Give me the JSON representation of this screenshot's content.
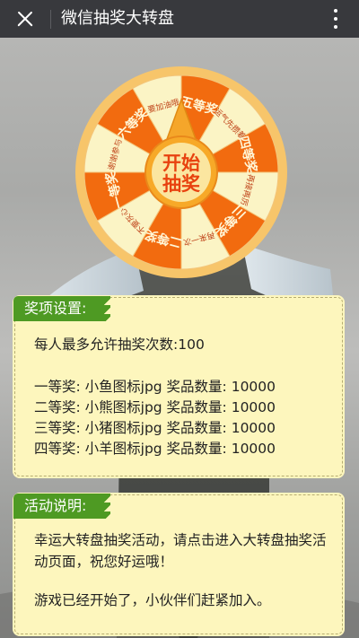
{
  "window": {
    "title": "微信抽奖大转盘"
  },
  "wheel": {
    "segments": [
      "六等奖",
      "要加油哦",
      "五等奖",
      "运气先攒着",
      "四等奖",
      "再接再厉",
      "三等奖",
      "再来一次",
      "二等奖",
      "不要灰心",
      "一等奖",
      "谢谢参与"
    ],
    "start_line1": "开始",
    "start_line2": "抽奖",
    "colors": {
      "orange": "#f26b0f",
      "cream": "#fbf4c5",
      "rim": "#f7c56a"
    }
  },
  "prize_panel": {
    "tag": "奖项设置:",
    "max_draws": "每人最多允许抽奖次数:100",
    "prizes": [
      "一等奖: 小鱼图标jpg 奖品数量: 10000",
      "二等奖: 小熊图标jpg 奖品数量: 10000",
      "三等奖: 小猪图标jpg 奖品数量: 10000",
      "四等奖: 小羊图标jpg 奖品数量: 10000"
    ]
  },
  "activity_panel": {
    "tag": "活动说明:",
    "line1": "幸运大转盘抽奖活动，请点击进入大转盘抽奖活",
    "line2": "动页面，祝您好运哦！",
    "line3": "游戏已经开始了，小伙伴们赶紧加入。"
  }
}
